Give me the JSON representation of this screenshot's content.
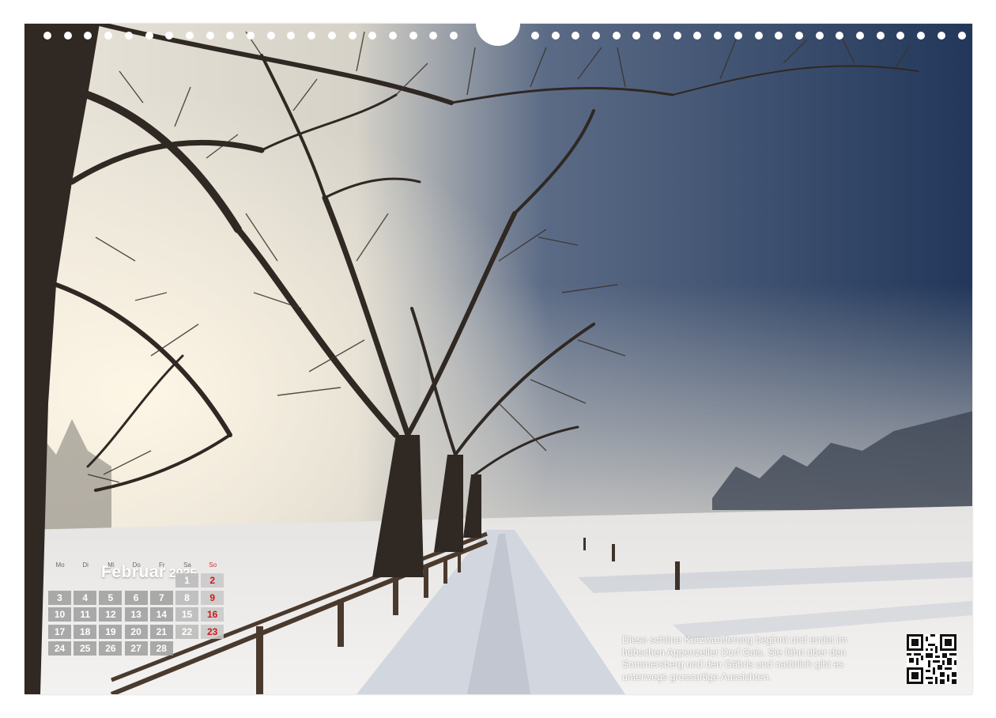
{
  "calendar": {
    "month": "Februar",
    "year": "2025",
    "weekdays": [
      "Mo",
      "Di",
      "Mi",
      "Do",
      "Fr",
      "Sa",
      "So"
    ],
    "days": [
      [
        "",
        "",
        "",
        "",
        "",
        "1",
        "2"
      ],
      [
        "3",
        "4",
        "5",
        "6",
        "7",
        "8",
        "9"
      ],
      [
        "10",
        "11",
        "12",
        "13",
        "14",
        "15",
        "16"
      ],
      [
        "17",
        "18",
        "19",
        "20",
        "21",
        "22",
        "23"
      ],
      [
        "24",
        "25",
        "26",
        "27",
        "28",
        "",
        ""
      ]
    ]
  },
  "caption": "Diese schöne Kurzwanderung beginnt und endet im hübschen Appenzeller Dorf Gais. Sie führt über den Sommersberg und den Gäbris und natürlich gibt es unterwegs grossartige Aussichten.",
  "photo": {
    "subject": "winter-tree-lined-snowy-path-in-fog"
  },
  "qr_code": {
    "icon": "qr-code"
  },
  "colors": {
    "sunday": "#d01818",
    "cell": "#969696",
    "sky": "#2e3f5e"
  }
}
